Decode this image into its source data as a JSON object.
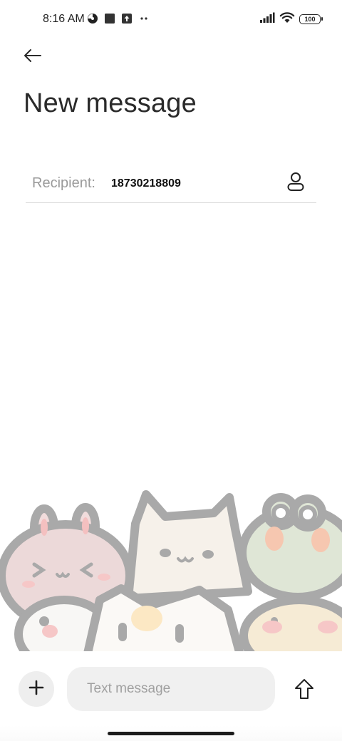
{
  "status_bar": {
    "time": "8:16 AM",
    "battery": "100",
    "left_icons": [
      "hotspot-icon",
      "stop-icon",
      "upload-notification-icon",
      "more-notifications-icon"
    ],
    "right_icons": [
      "signal-icon",
      "wifi-icon",
      "battery-icon"
    ]
  },
  "header": {
    "back_icon": "back-arrow-icon",
    "title": "New message"
  },
  "recipient": {
    "label": "Recipient:",
    "value": "18730218809",
    "contact_icon": "contact-person-icon"
  },
  "compose": {
    "add_icon": "plus-icon",
    "placeholder": "Text message",
    "value": "",
    "send_icon": "send-arrow-icon"
  },
  "colors": {
    "background": "#ffffff",
    "title": "#2a2a2a",
    "label": "#9a9a9a",
    "input_bg": "#f0f0f0",
    "button_bg": "#eeeeee"
  }
}
